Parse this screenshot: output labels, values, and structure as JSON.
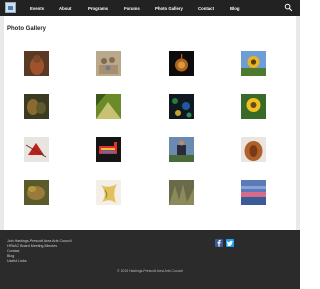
{
  "nav": {
    "items": [
      {
        "label": "Events"
      },
      {
        "label": "About"
      },
      {
        "label": "Programs"
      },
      {
        "label": "Forums"
      },
      {
        "label": "Photo Gallery"
      },
      {
        "label": "Contact"
      },
      {
        "label": "Blog"
      }
    ]
  },
  "page": {
    "title": "Photo Gallery"
  },
  "gallery": {
    "rows": 4,
    "cols": 4,
    "count": 16
  },
  "footer": {
    "links": [
      {
        "label": "Join Hastings-Prescott Area Arts Council"
      },
      {
        "label": "HPAAC Board Meeting Minutes"
      },
      {
        "label": "Contact"
      },
      {
        "label": "Blog"
      },
      {
        "label": "Useful Links"
      }
    ],
    "copyright": "© 2015 Hastings-Prescott Area Arts Council"
  },
  "colors": {
    "topbar": "#222222",
    "footer": "#2b2b2b",
    "facebook": "#3b5998",
    "twitter": "#1da1f2"
  }
}
